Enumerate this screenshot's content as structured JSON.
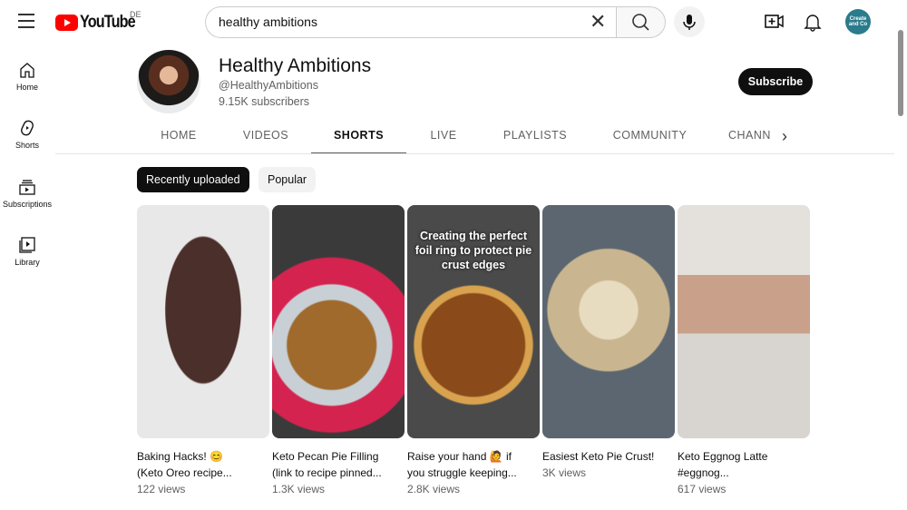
{
  "header": {
    "logo": "YouTube",
    "region": "DE",
    "search_value": "healthy ambitions",
    "avatar_text": "Create and Co"
  },
  "sidebar": {
    "items": [
      {
        "label": "Home",
        "icon": "home-icon"
      },
      {
        "label": "Shorts",
        "icon": "shorts-icon"
      },
      {
        "label": "Subscriptions",
        "icon": "subscriptions-icon"
      },
      {
        "label": "Library",
        "icon": "library-icon"
      }
    ]
  },
  "channel": {
    "name": "Healthy Ambitions",
    "handle": "@HealthyAmbitions",
    "subscribers": "9.15K subscribers",
    "subscribe_label": "Subscribe"
  },
  "tabs": [
    {
      "label": "HOME"
    },
    {
      "label": "VIDEOS"
    },
    {
      "label": "SHORTS",
      "active": true
    },
    {
      "label": "LIVE"
    },
    {
      "label": "PLAYLISTS"
    },
    {
      "label": "COMMUNITY"
    },
    {
      "label": "CHANN"
    }
  ],
  "chips": [
    {
      "label": "Recently uploaded",
      "active": true
    },
    {
      "label": "Popular"
    }
  ],
  "shorts": [
    {
      "title1": "Baking Hacks! 😊",
      "title2": "(Keto Oreo recipe...",
      "views": "122 views"
    },
    {
      "title1": "Keto Pecan Pie Filling",
      "title2": "(link to recipe pinned...",
      "views": "1.3K views"
    },
    {
      "title1": "Raise your hand 🙋 if",
      "title2": "you struggle keeping...",
      "views": "2.8K views",
      "overlay": "Creating the perfect foil ring to protect pie crust edges"
    },
    {
      "title1": "Easiest Keto Pie Crust!",
      "title2": "",
      "views": "3K views"
    },
    {
      "title1": "Keto Eggnog Latte",
      "title2": "#eggnog...",
      "views": "617 views"
    }
  ]
}
